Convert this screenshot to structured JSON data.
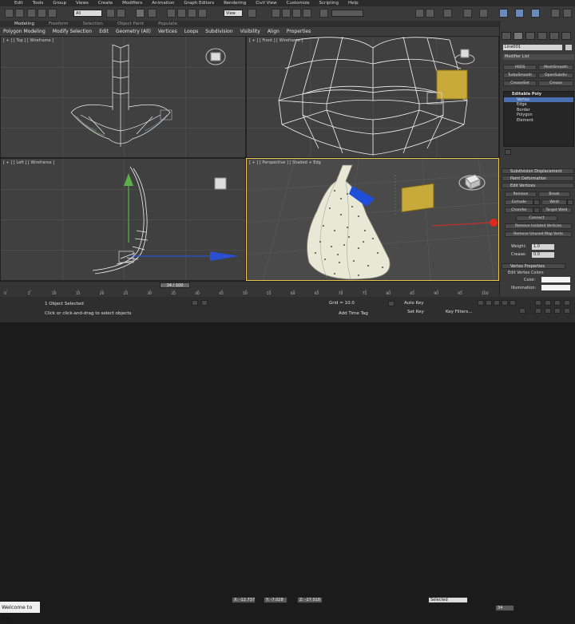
{
  "menubar": [
    "Edit",
    "Tools",
    "Group",
    "Views",
    "Create",
    "Modifiers",
    "Animation",
    "Graph Editors",
    "Rendering",
    "Civil View",
    "Customize",
    "Scripting",
    "Help"
  ],
  "toolbar": {
    "selection_filter": "All",
    "ref_coord": "View"
  },
  "ribbon_tabs": [
    "Modeling",
    "Freeform",
    "Selection",
    "Object Paint",
    "Populate"
  ],
  "ribbon_items": [
    "Polygon Modeling",
    "Modify Selection",
    "Edit",
    "Geometry (All)",
    "Vertices",
    "Loops",
    "Subdivision",
    "Visibility",
    "Align",
    "Properties"
  ],
  "viewports": {
    "top": "[ + ] [ Top ] [ Wireframe ]",
    "front": "[ + ] [ Front ] [ Wireframe ]",
    "left": "[ + ] [ Left ] [ Wireframe ]",
    "perspective": "[ + ] [ Perspective ] [ Shaded + Edg"
  },
  "command_panel": {
    "object_name": "Line001",
    "modifier_list": "Modifier List",
    "buttons": [
      "HSDS",
      "MeshSmooth",
      "TurboSmooth",
      "OpenSubdiv",
      "CreaseSet",
      "Crease"
    ],
    "stack": [
      {
        "label": "Editable Poly",
        "selected": false
      },
      {
        "label": "Vertex",
        "selected": true
      },
      {
        "label": "Edge",
        "selected": false
      },
      {
        "label": "Border",
        "selected": false
      },
      {
        "label": "Polygon",
        "selected": false
      },
      {
        "label": "Element",
        "selected": false
      }
    ],
    "rollouts": [
      "Subdivision Displacement",
      "Paint Deformation",
      "Edit Vertices"
    ],
    "edit_vertices": [
      "Remove",
      "Break",
      "Extrude",
      "Weld",
      "Chamfer",
      "Target Weld",
      "Connect",
      "Remove Isolated Vertices",
      "Remove Unused Map Verts"
    ],
    "weight_label": "Weight:",
    "weight_value": "1.0",
    "crease_label": "Crease:",
    "crease_value": "0.0",
    "vertex_properties": "Vertex Properties",
    "edit_vertex_colors": "Edit Vertex Colors",
    "color_label": "Color:",
    "illumination_label": "Illumination:"
  },
  "timeline": {
    "frame": "34 / 100",
    "ticks": [
      "0",
      "5",
      "10",
      "15",
      "20",
      "25",
      "30",
      "35",
      "40",
      "45",
      "50",
      "55",
      "60",
      "65",
      "70",
      "75",
      "80",
      "85",
      "90",
      "95",
      "100"
    ]
  },
  "status": {
    "maxscript": "Welcome to MA",
    "selection": "1 Object Selected",
    "prompt": "Click or click-and-drag to select objects",
    "x": "X: -12.737",
    "y": "Y: -7.028",
    "z": "Z: -27.018",
    "grid": "Grid = 10.0",
    "add_time_tag": "Add Time Tag",
    "auto_key": "Auto Key",
    "selected": "Selected",
    "set_key": "Set Key",
    "key_filters": "Key Filters...",
    "frame_field": "34"
  }
}
